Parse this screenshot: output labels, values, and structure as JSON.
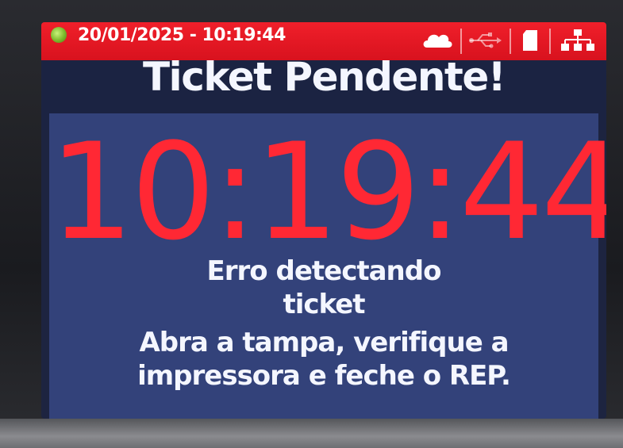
{
  "status_bar": {
    "datetime": "20/01/2025 - 10:19:44",
    "icons": [
      "status-led-icon",
      "cloud-icon",
      "usb-icon",
      "sd-card-icon",
      "network-icon"
    ],
    "bar_color": "#e8141f",
    "led_color": "#7ab82a"
  },
  "header": {
    "title": "Ticket Pendente!"
  },
  "main": {
    "clock": "10:19:44",
    "clock_color": "#ff2834",
    "message_lines": [
      "Erro detectando",
      "ticket",
      "Abra a tampa, verifique a",
      "impressora e feche o REP."
    ]
  }
}
